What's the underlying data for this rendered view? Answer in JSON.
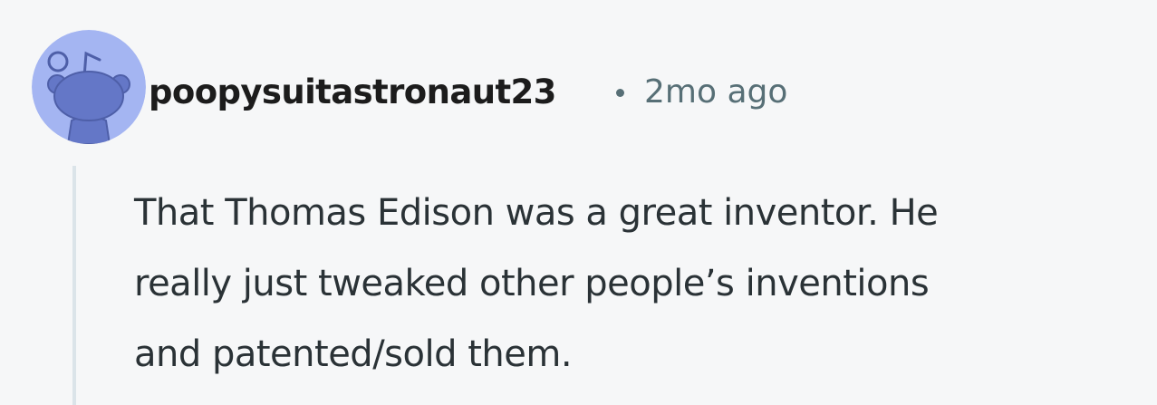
{
  "comment": {
    "author": "poopysuitastronaut23",
    "separator": "•",
    "timestamp": "2mo ago",
    "avatar_icon": "snoo-avatar-icon",
    "body_lines": [
      "That Thomas Edison was a great inventor. He",
      "really just tweaked other people’s inventions",
      "and patented/sold them."
    ]
  },
  "colors": {
    "background": "#f6f7f8",
    "avatar_bg": "#a4b5f2",
    "avatar_figure": "#6477c7",
    "meta_text": "#576f76",
    "thread_line": "#dbe4e9"
  }
}
